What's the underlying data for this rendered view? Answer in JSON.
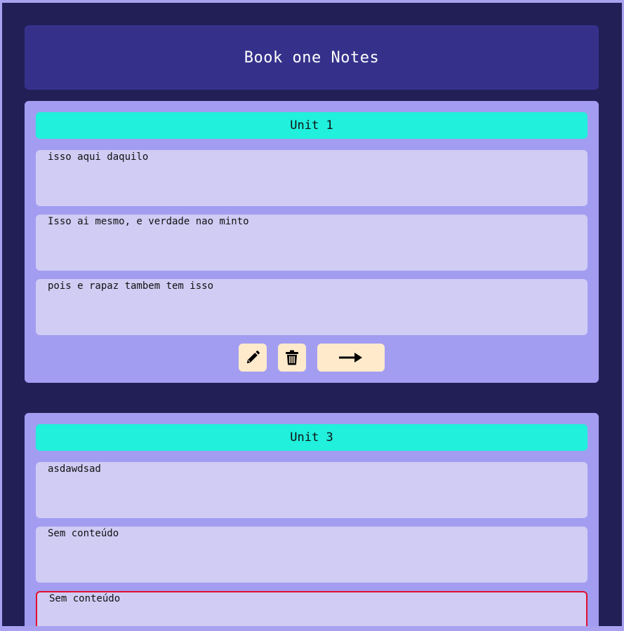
{
  "header": {
    "title": "Book one Notes"
  },
  "units": [
    {
      "title": "Unit 1",
      "notes": [
        "isso aqui daquilo",
        "Isso ai mesmo, e verdade nao minto",
        "pois e rapaz tambem tem isso"
      ],
      "actions": {
        "edit_icon": "pencil-icon",
        "delete_icon": "trash-icon",
        "next_icon": "arrow-right-icon"
      }
    },
    {
      "title": "Unit 3",
      "notes": [
        "asdawdsad",
        "Sem conteúdo",
        "Sem conteúdo"
      ]
    }
  ],
  "colors": {
    "page_background": "#221f57",
    "header_background": "#35318b",
    "card_background": "#a29df1",
    "unit_title_background": "#20f0dc",
    "note_background": "#d0ccf4",
    "button_background": "#ffebcc",
    "focus_border": "#e0102a"
  }
}
